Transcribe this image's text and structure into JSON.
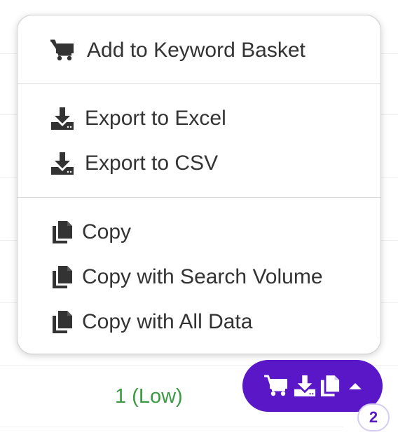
{
  "menu": {
    "sections": [
      {
        "items": [
          {
            "label": "Add to Keyword Basket",
            "icon": "cart-icon"
          }
        ]
      },
      {
        "items": [
          {
            "label": "Export to Excel",
            "icon": "download-icon"
          },
          {
            "label": "Export to CSV",
            "icon": "download-icon"
          }
        ]
      },
      {
        "items": [
          {
            "label": "Copy",
            "icon": "copy-icon"
          },
          {
            "label": "Copy with Search Volume",
            "icon": "copy-icon"
          },
          {
            "label": "Copy with All Data",
            "icon": "copy-icon"
          }
        ]
      }
    ]
  },
  "background": {
    "cell_value": "1 (Low)",
    "cell_value_color": "#3c9a44"
  },
  "action_button": {
    "icons": [
      "cart-icon",
      "download-icon",
      "copy-icon",
      "caret-up-icon"
    ],
    "color": "#5a17c8",
    "badge_count": "2"
  },
  "colors": {
    "icon": "#333333",
    "text": "#333333",
    "accent": "#5a17c8"
  }
}
